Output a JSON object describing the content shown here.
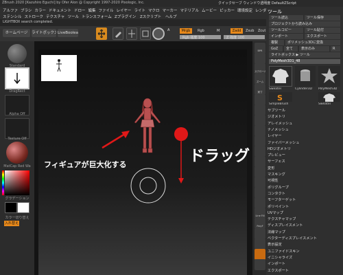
{
  "window": {
    "title": "ZBrush 2020 [Kazuhiro Eguchi] by Ofer Alon @ Copyright 1997-2020 Pixologic, Inc.",
    "right_menu": "クイックセーブ ウィンドウ透明度 DefaultZScript"
  },
  "menubar": {
    "row1": [
      "アルファ",
      "ブラシ",
      "カラー",
      "ドキュメント",
      "ドロー",
      "編集",
      "ファイル",
      "レイヤー",
      "ライト",
      "マクロ",
      "マーカー",
      "マテリアル",
      "ムービー",
      "ピッカー",
      "環境設定",
      "レンダー"
    ],
    "row2": [
      "ステンシル",
      "ストローク",
      "テクスチャ",
      "ツール",
      "トランスフォーム",
      "Zプラグイン",
      "Zスクリプト",
      "ヘルプ"
    ]
  },
  "status": "LIGHTBOX search completed.",
  "toolbar": {
    "home": "ホームページ",
    "lightbox": "ライトボックス",
    "liveboolean": "LiveBoolean",
    "a_label": "A",
    "mrgb": "Mrgb",
    "rgb": "Rgb",
    "m": "M",
    "zadd": "Zadd",
    "zsub": "Zsub",
    "zcut": "Zcut",
    "rgb_intensity": "Rgb 強度 100",
    "z_intensity": "Z 強度 100",
    "rgb_intensity_value": 100,
    "z_intensity_value": 100
  },
  "left": {
    "standard": "Standard",
    "dragrect": "DragRect",
    "alpha_off": "Alpha Off",
    "texture_off": "Texture Off",
    "matcap": "MatCap Red Wa",
    "gradation": "グラデーション",
    "color_switch": "カラー切り替え",
    "swap": "入れ替え"
  },
  "right_shelf": [
    "BPR",
    "",
    "スクロール",
    "ズーム",
    "実寸",
    "",
    "",
    "",
    "",
    "",
    "",
    "",
    "",
    "",
    "",
    "",
    "Line Fill",
    "PolyF",
    "",
    "",
    "",
    ""
  ],
  "tray": {
    "title": "ツール",
    "row1": [
      "ツール読込",
      "ツール保存"
    ],
    "row2": [
      "プロジェクトから読み込み"
    ],
    "row3": [
      "ツールコピー",
      "ツール貼付"
    ],
    "row4": [
      "インポート",
      "エクスポート"
    ],
    "clone": "複製",
    "polymesh": "ポリメッシュ3Dに変換",
    "goz": "GoZ",
    "all": "全て",
    "visible": "表示のみ",
    "r": "R",
    "lightbox_tool": "ライトボックス ▶ ツール",
    "polymesh_name": "PolyMesh3D1_48",
    "thumbs": [
      "Sweater",
      "Cylinder3D",
      "PolyMesh3D",
      "SimpleBrush",
      "Sweater"
    ],
    "list": [
      "サブツール",
      "ジオメトリ",
      "アレイメッシュ",
      "ナノメッシュ",
      "レイヤー",
      "ファイバーメッシュ",
      "HDジオメトリ",
      "プレビュー",
      "サーフェス",
      "変形",
      "マスキング",
      "可視性",
      "ポリグループ",
      "コンタクト",
      "モーフターゲット",
      "ポリペイント",
      "UVマップ",
      "テクスチャマップ",
      "ディスプレイスメント",
      "法線マップ",
      "ベクターディスプレイスメント",
      "表示設定",
      "ユニファイドスキン",
      "イニシャライズ",
      "インポート",
      "エクスポート"
    ]
  },
  "annotations": {
    "figure_grow": "フィギュアが巨大化する",
    "drag": "ドラッグ"
  },
  "colors": {
    "accent": "#e8891a",
    "annotation_red": "#e01818"
  }
}
